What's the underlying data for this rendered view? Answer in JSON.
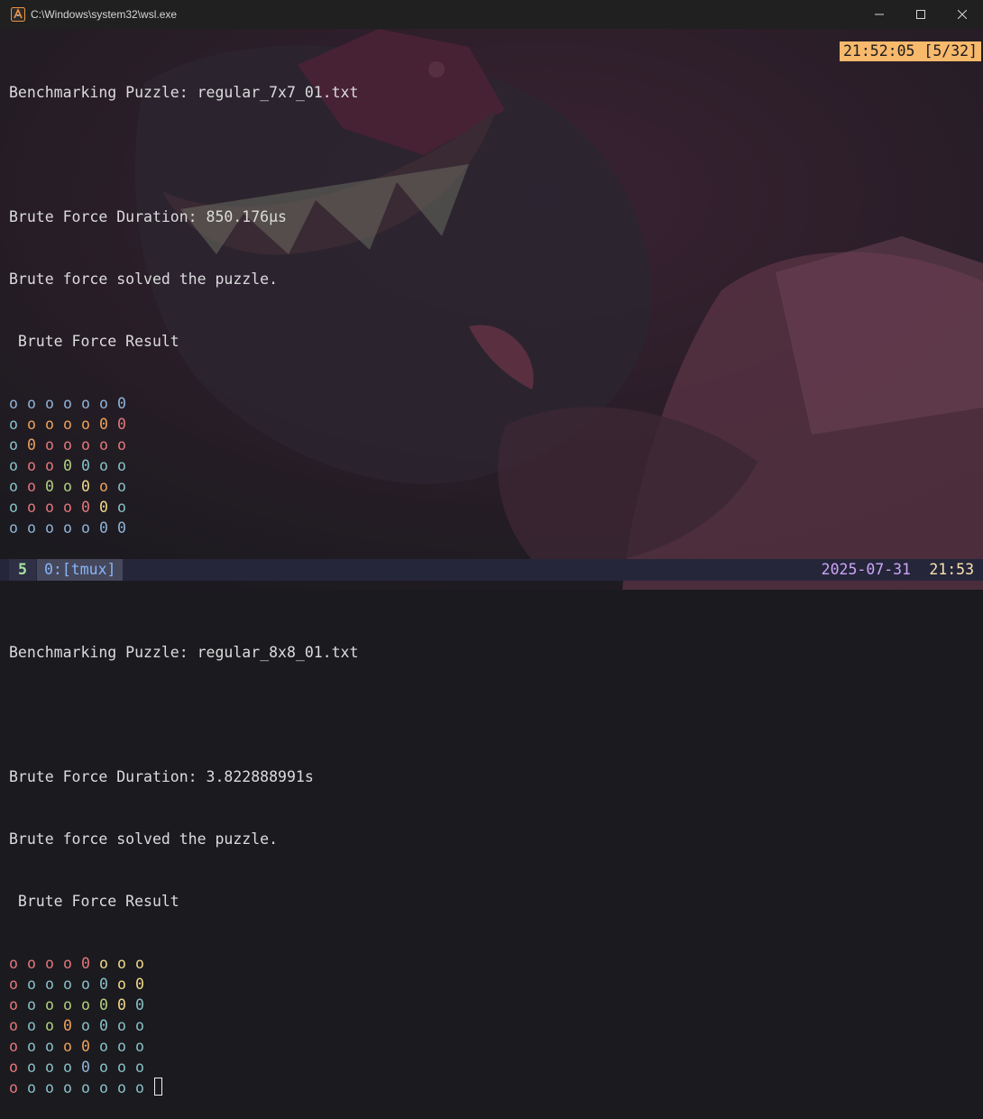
{
  "window": {
    "title": "C:\\Windows\\system32\\wsl.exe",
    "icon": "wsl-terminal-icon",
    "controls": [
      "minimize-icon",
      "maximize-icon",
      "close-icon"
    ]
  },
  "terminal": {
    "clock": "21:52:05 [5/32]",
    "blocks": [
      {
        "header": "Benchmarking Puzzle: regular_7x7_01.txt",
        "duration": "Brute Force Duration: 850.176µs",
        "solved": "Brute force solved the puzzle.",
        "result_label": " Brute Force Result",
        "grid": [
          [
            [
              "o",
              "blue"
            ],
            [
              "o",
              "blue"
            ],
            [
              "o",
              "blue"
            ],
            [
              "o",
              "blue"
            ],
            [
              "o",
              "blue"
            ],
            [
              "o",
              "blue"
            ],
            [
              "0",
              "blue"
            ]
          ],
          [
            [
              "o",
              "teal"
            ],
            [
              "o",
              "orange"
            ],
            [
              "o",
              "orange"
            ],
            [
              "o",
              "orange"
            ],
            [
              "o",
              "orange"
            ],
            [
              "0",
              "orange"
            ],
            [
              "0",
              "red"
            ]
          ],
          [
            [
              "o",
              "teal"
            ],
            [
              "0",
              "orange"
            ],
            [
              "o",
              "red"
            ],
            [
              "o",
              "red"
            ],
            [
              "o",
              "red"
            ],
            [
              "o",
              "red"
            ],
            [
              "o",
              "red"
            ]
          ],
          [
            [
              "o",
              "teal"
            ],
            [
              "o",
              "red"
            ],
            [
              "o",
              "red"
            ],
            [
              "0",
              "green"
            ],
            [
              "0",
              "teal"
            ],
            [
              "o",
              "teal"
            ],
            [
              "o",
              "teal"
            ]
          ],
          [
            [
              "o",
              "teal"
            ],
            [
              "o",
              "red"
            ],
            [
              "0",
              "green"
            ],
            [
              "o",
              "green"
            ],
            [
              "0",
              "yellow"
            ],
            [
              "o",
              "orange"
            ],
            [
              "o",
              "teal"
            ]
          ],
          [
            [
              "o",
              "teal"
            ],
            [
              "o",
              "red"
            ],
            [
              "o",
              "red"
            ],
            [
              "o",
              "red"
            ],
            [
              "0",
              "red"
            ],
            [
              "0",
              "yellow"
            ],
            [
              "o",
              "teal"
            ]
          ],
          [
            [
              "o",
              "blue"
            ],
            [
              "o",
              "blue"
            ],
            [
              "o",
              "blue"
            ],
            [
              "o",
              "blue"
            ],
            [
              "o",
              "blue"
            ],
            [
              "0",
              "blue"
            ],
            [
              "0",
              "blue"
            ]
          ]
        ]
      },
      {
        "header": "Benchmarking Puzzle: regular_8x8_01.txt",
        "duration": "Brute Force Duration: 3.822888991s",
        "solved": "Brute force solved the puzzle.",
        "result_label": " Brute Force Result",
        "grid": [
          [
            [
              "o",
              "red"
            ],
            [
              "o",
              "red"
            ],
            [
              "o",
              "red"
            ],
            [
              "o",
              "red"
            ],
            [
              "0",
              "red"
            ],
            [
              "o",
              "yellow"
            ],
            [
              "o",
              "yellow"
            ],
            [
              "o",
              "yellow"
            ]
          ],
          [
            [
              "o",
              "red"
            ],
            [
              "o",
              "teal"
            ],
            [
              "o",
              "teal"
            ],
            [
              "o",
              "teal"
            ],
            [
              "o",
              "teal"
            ],
            [
              "0",
              "teal"
            ],
            [
              "o",
              "yellow"
            ],
            [
              "0",
              "yellow"
            ]
          ],
          [
            [
              "o",
              "red"
            ],
            [
              "o",
              "teal"
            ],
            [
              "o",
              "green"
            ],
            [
              "o",
              "green"
            ],
            [
              "o",
              "green"
            ],
            [
              "0",
              "green"
            ],
            [
              "0",
              "yellow"
            ],
            [
              "0",
              "teal"
            ]
          ],
          [
            [
              "o",
              "red"
            ],
            [
              "o",
              "teal"
            ],
            [
              "o",
              "green"
            ],
            [
              "0",
              "orange"
            ],
            [
              "o",
              "teal"
            ],
            [
              "0",
              "teal"
            ],
            [
              "o",
              "teal"
            ],
            [
              "o",
              "teal"
            ]
          ],
          [
            [
              "o",
              "red"
            ],
            [
              "o",
              "teal"
            ],
            [
              "o",
              "teal"
            ],
            [
              "o",
              "orange"
            ],
            [
              "0",
              "orange"
            ],
            [
              "o",
              "teal"
            ],
            [
              "o",
              "teal"
            ],
            [
              "o",
              "teal"
            ]
          ],
          [
            [
              "o",
              "red"
            ],
            [
              "o",
              "teal"
            ],
            [
              "o",
              "teal"
            ],
            [
              "o",
              "teal"
            ],
            [
              "0",
              "blue"
            ],
            [
              "o",
              "teal"
            ],
            [
              "o",
              "teal"
            ],
            [
              "o",
              "teal"
            ]
          ],
          [
            [
              "o",
              "red"
            ],
            [
              "o",
              "teal"
            ],
            [
              "o",
              "teal"
            ],
            [
              "o",
              "teal"
            ],
            [
              "o",
              "teal"
            ],
            [
              "o",
              "teal"
            ],
            [
              "o",
              "teal"
            ],
            [
              "o",
              "teal"
            ]
          ]
        ]
      }
    ]
  },
  "status_bar": {
    "session": "5",
    "window": "0:[tmux]",
    "date": "2025-07-31",
    "time": "21:53"
  },
  "colors": {
    "blue": "#8fb4d9",
    "teal": "#87c2c8",
    "orange": "#f0a25a",
    "red": "#e5777b",
    "green": "#b3d17e",
    "yellow": "#f2d98a"
  }
}
